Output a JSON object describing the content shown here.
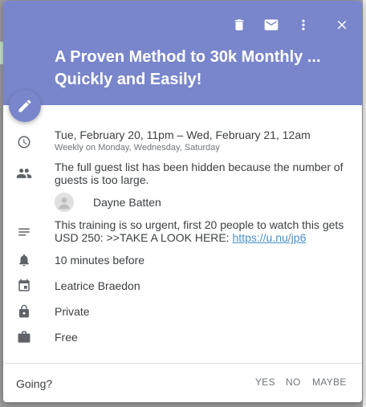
{
  "event": {
    "title": "A Proven Method to 30k Monthly ... Quickly and Easily!",
    "time": "Tue, February 20, 11pm – Wed, February 21, 12am",
    "recurrence": "Weekly on Monday, Wednesday, Saturday",
    "guests_note": "The full guest list has been hidden because the number of guests is too large.",
    "guest_name": "Dayne Batten",
    "description_text": "This training is so urgent, first 20 people to watch this gets USD 250: >>TAKE A LOOK HERE: ",
    "description_link": "https://u.nu/jp6",
    "reminder": "10 minutes before",
    "calendar_owner": "Leatrice Braedon",
    "visibility": "Private",
    "availability": "Free"
  },
  "rsvp": {
    "prompt": "Going?",
    "yes": "YES",
    "no": "NO",
    "maybe": "MAYBE"
  },
  "colors": {
    "header": "#7986cb",
    "icon": "#5f6368",
    "link": "#4a90c8"
  },
  "icons": [
    "trash-icon",
    "email-icon",
    "more-vert-icon",
    "close-icon",
    "edit-pencil-icon",
    "clock-icon",
    "people-icon",
    "notes-icon",
    "bell-icon",
    "calendar-icon",
    "lock-icon",
    "briefcase-icon"
  ]
}
